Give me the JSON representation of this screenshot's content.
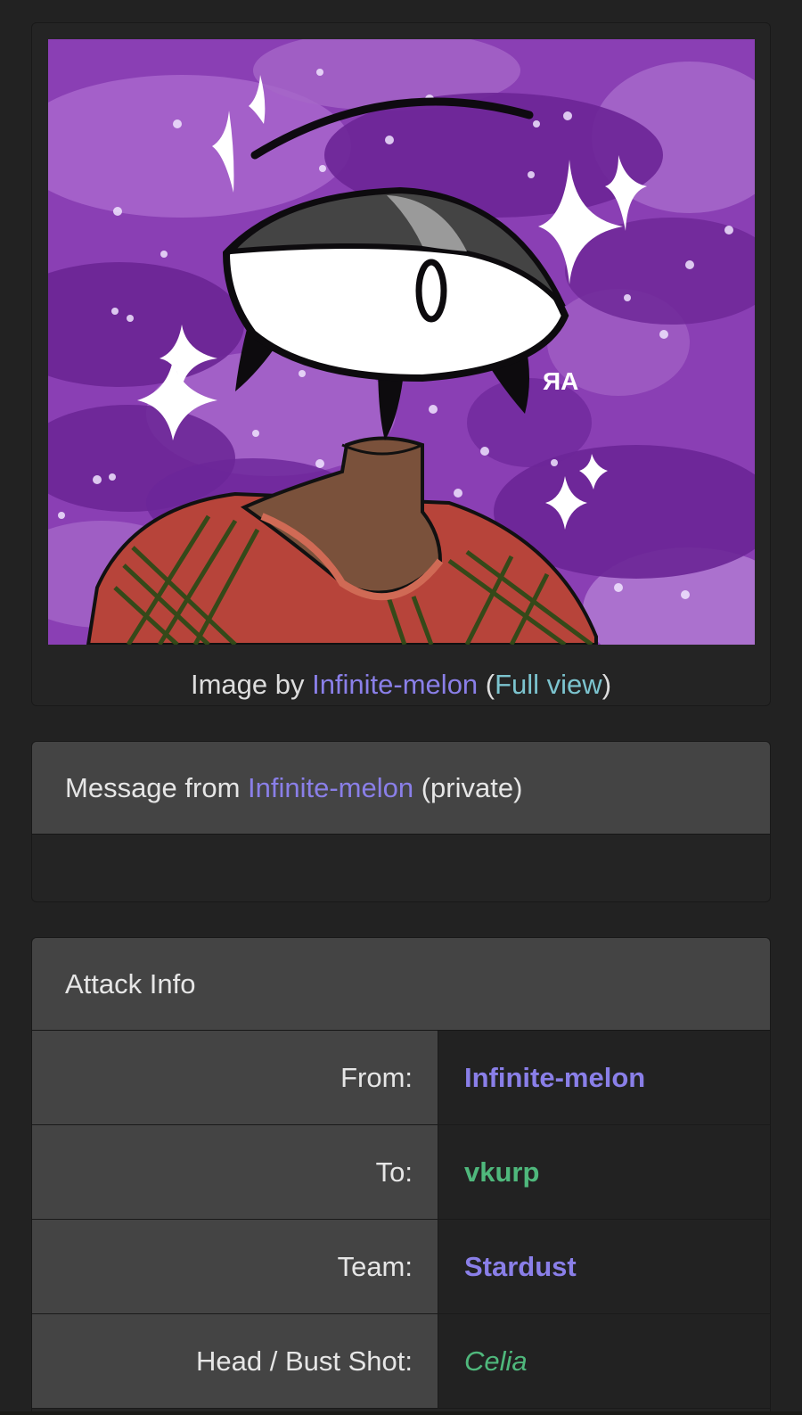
{
  "image_card": {
    "caption_prefix": "Image by ",
    "artist": "Infinite-melon",
    "open_paren": " (",
    "full_view": "Full view",
    "close_paren": ")",
    "signature": "ЯA"
  },
  "message": {
    "prefix": "Message from ",
    "sender": "Infinite-melon",
    "suffix": " (private)",
    "body": ""
  },
  "attack_info": {
    "title": "Attack Info",
    "rows": [
      {
        "label": "From:",
        "value": "Infinite-melon"
      },
      {
        "label": "To:",
        "value": "vkurp"
      },
      {
        "label": "Team:",
        "value": "Stardust"
      },
      {
        "label": "Head / Bust Shot:",
        "value": "Celia"
      }
    ]
  },
  "colors": {
    "background": "#222222",
    "panel_header": "#444444",
    "link_purple": "#8a7fe8",
    "link_teal": "#7cc4cf",
    "value_green": "#4fb87c"
  }
}
